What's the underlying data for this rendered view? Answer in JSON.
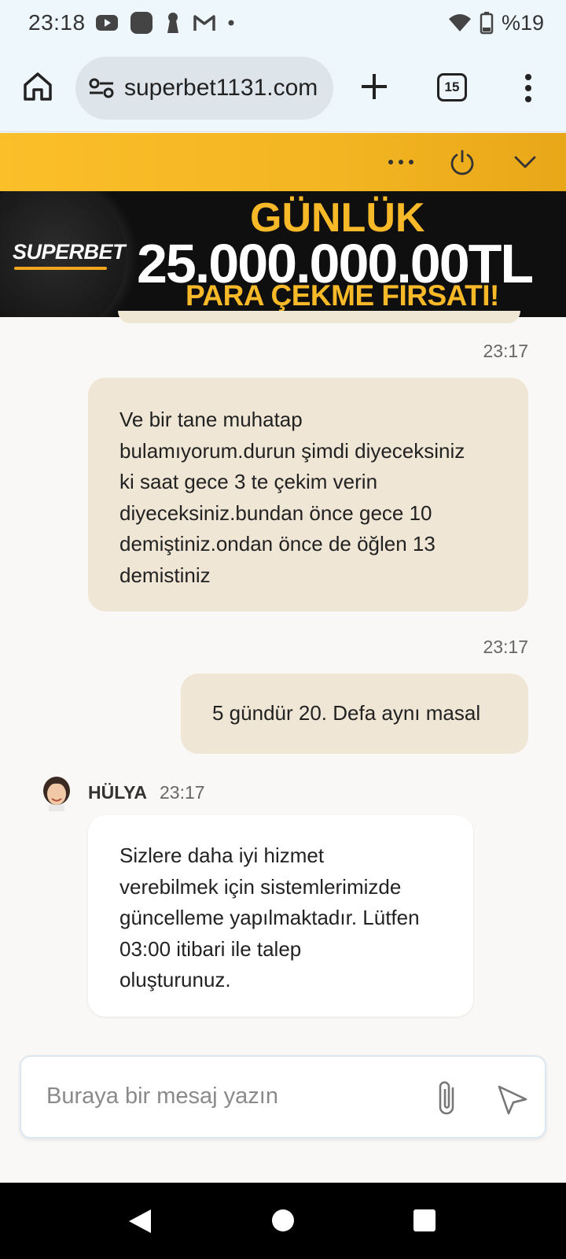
{
  "status_bar": {
    "time": "23:18",
    "battery": "%19",
    "icons": [
      "youtube-icon",
      "app-icon",
      "keyhole-icon",
      "gmail-icon",
      "dot-icon",
      "wifi-icon",
      "battery-icon"
    ]
  },
  "browser": {
    "url": "superbet1131.com",
    "tab_count": "15",
    "icons": [
      "home-icon",
      "site-settings-icon",
      "plus-icon",
      "kebab-menu-icon"
    ]
  },
  "chat_header": {
    "icons": [
      "more-horizontal-icon",
      "power-icon",
      "chevron-down-icon"
    ],
    "bg_color": "#f3b522"
  },
  "banner": {
    "logo": "SUPERBET",
    "line1": "GÜNLÜK",
    "line2": "25.000.000.00TL",
    "line3": "PARA ÇEKME FIRSATI!",
    "accent_color": "#f7b928"
  },
  "messages": [
    {
      "sender": "user",
      "time": "23:17",
      "lines": [
        "Ve bir tane muhatap",
        "bulamıyorum.durun şimdi diyeceksiniz",
        "ki saat gece 3 te çekim verin",
        "diyeceksiniz.bundan önce gece 10",
        "demiştiniz.ondan önce de öğlen 13",
        "demistiniz"
      ]
    },
    {
      "sender": "user",
      "time": "23:17",
      "lines": [
        "5 gündür 20. Defa aynı masal"
      ]
    },
    {
      "sender": "agent",
      "name": "HÜLYA",
      "time": "23:17",
      "lines": [
        "Sizlere daha iyi hizmet",
        "verebilmek için sistemlerimizde",
        "güncelleme yapılmaktadır. Lütfen",
        "03:00 itibari ile talep",
        "oluşturunuz."
      ]
    }
  ],
  "composer": {
    "placeholder": "Buraya bir mesaj yazın",
    "icons": [
      "paperclip-icon",
      "send-icon"
    ]
  },
  "nav_bar": {
    "icons": [
      "back-icon",
      "home-icon",
      "recents-icon"
    ]
  }
}
